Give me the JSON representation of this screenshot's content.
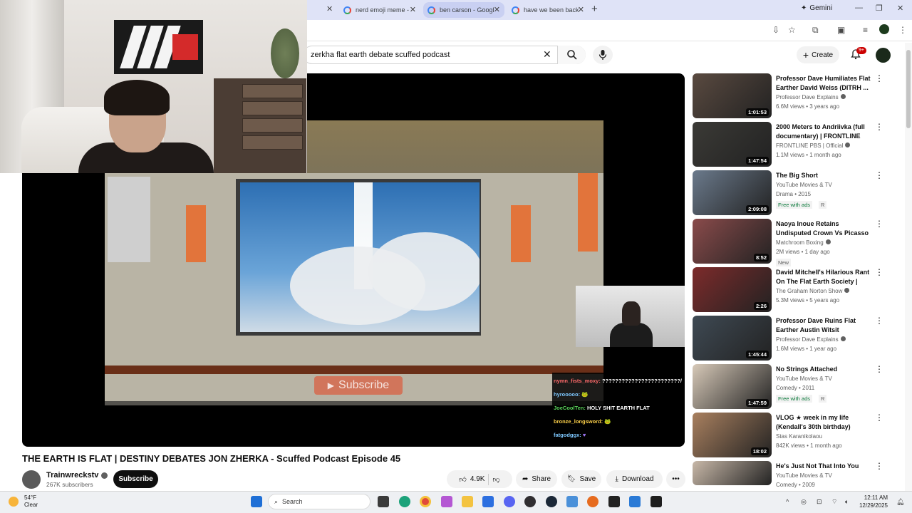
{
  "browser": {
    "tabs": [
      {
        "label": "nerd emoji meme -"
      },
      {
        "label": "ben carson - Googl"
      },
      {
        "label": "have we been back"
      }
    ],
    "gemini_label": "Gemini"
  },
  "youtube": {
    "search_value": "zerkha flat earth debate scuffed podcast",
    "create_label": "Create",
    "notifications_badge": "9+"
  },
  "stream_overlay": {
    "subscribe_overlay": "Subscribe",
    "chat": [
      {
        "user": "nymn_fists_moxy:",
        "msg": "????????????????????????/"
      },
      {
        "user": "hyrooooo:",
        "msg": ""
      },
      {
        "user": "JoeCoolTen:",
        "msg": "HOLY SHIT EARTH FLAT"
      },
      {
        "user": "bronze_longsword:",
        "msg": ""
      },
      {
        "user": "fatgodggx:",
        "msg": ""
      }
    ]
  },
  "video": {
    "title": "THE EARTH IS FLAT | DESTINY DEBATES JON ZHERKA - Scuffed Podcast Episode 45",
    "channel": "Trainwreckstv",
    "subscribers": "267K subscribers",
    "subscribe_label": "Subscribe",
    "likes": "4.9K",
    "share_label": "Share",
    "save_label": "Save",
    "download_label": "Download"
  },
  "recommendations": [
    {
      "title": "Professor Dave Humiliates Flat Earther David Weiss (DITRH ...",
      "channel": "Professor Dave Explains",
      "verified": true,
      "meta": "6.6M views • 3 years ago",
      "duration": "1:01:53",
      "tag": "",
      "rating": ""
    },
    {
      "title": "2000 Meters to Andriivka (full documentary) | FRONTLINE",
      "channel": "FRONTLINE PBS | Official",
      "verified": true,
      "meta": "1.1M views • 1 month ago",
      "duration": "1:47:54",
      "tag": "",
      "rating": ""
    },
    {
      "title": "The Big Short",
      "channel": "YouTube Movies & TV",
      "verified": false,
      "meta": "Drama • 2015",
      "duration": "2:09:08",
      "tag": "Free with ads",
      "rating": "R"
    },
    {
      "title": "Naoya Inoue Retains Undisputed Crown Vs Picasso ...",
      "channel": "Matchroom Boxing",
      "verified": true,
      "meta": "2M views • 1 day ago",
      "duration": "8:52",
      "tag": "New",
      "rating": ""
    },
    {
      "title": "David Mitchell's Hilarious Rant On The Flat Earth Society | The...",
      "channel": "The Graham Norton Show",
      "verified": true,
      "meta": "5.3M views • 5 years ago",
      "duration": "2:26",
      "tag": "",
      "rating": ""
    },
    {
      "title": "Professor Dave Ruins Flat Earther Austin Witsit",
      "channel": "Professor Dave Explains",
      "verified": true,
      "meta": "1.6M views • 1 year ago",
      "duration": "1:45:44",
      "tag": "",
      "rating": ""
    },
    {
      "title": "No Strings Attached",
      "channel": "YouTube Movies & TV",
      "verified": false,
      "meta": "Comedy • 2011",
      "duration": "1:47:59",
      "tag": "Free with ads",
      "rating": "R"
    },
    {
      "title": "VLOG ★ week in my life (Kendall's 30th birthday)",
      "channel": "Stas Karanikolaou",
      "verified": false,
      "meta": "842K views • 1 month ago",
      "duration": "18:02",
      "tag": "",
      "rating": ""
    },
    {
      "title": "He's Just Not That Into You",
      "channel": "YouTube Movies & TV",
      "verified": false,
      "meta": "Comedy • 2009",
      "duration": "",
      "tag": "",
      "rating": ""
    }
  ],
  "taskbar": {
    "temp": "54°F",
    "condition": "Clear",
    "search_placeholder": "Search",
    "time": "12:11 AM",
    "date": "12/29/2025"
  }
}
